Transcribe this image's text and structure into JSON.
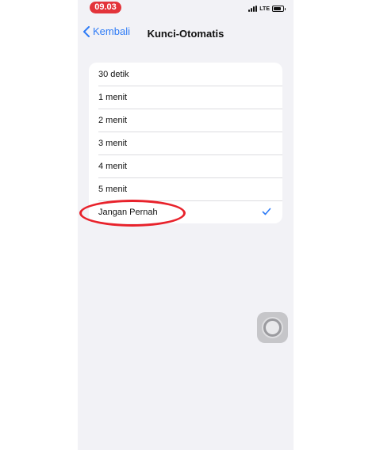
{
  "status_bar": {
    "time": "09.03",
    "network": "LTE",
    "icons": [
      "signal-icon",
      "battery-icon"
    ]
  },
  "nav": {
    "back_label": "Kembali",
    "title": "Kunci-Otomatis",
    "back_icon": "chevron-left-icon"
  },
  "options": [
    {
      "label": "30 detik",
      "selected": false
    },
    {
      "label": "1 menit",
      "selected": false
    },
    {
      "label": "2 menit",
      "selected": false
    },
    {
      "label": "3 menit",
      "selected": false
    },
    {
      "label": "4 menit",
      "selected": false
    },
    {
      "label": "5 menit",
      "selected": false
    },
    {
      "label": "Jangan Pernah",
      "selected": true
    }
  ],
  "colors": {
    "accent": "#2f7cf6",
    "time_pill": "#e3343a",
    "annotation": "#e8222b",
    "background": "#f2f2f6"
  }
}
